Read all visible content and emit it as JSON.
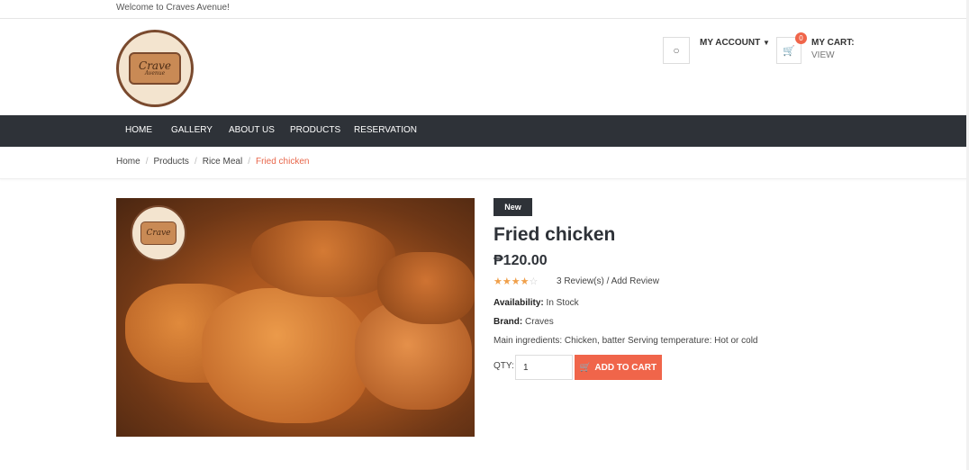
{
  "topbar": {
    "welcome": "Welcome to Craves Avenue!"
  },
  "header": {
    "logo": {
      "line1": "Crave",
      "line2": "Avenue"
    },
    "account": {
      "label": "MY ACCOUNT",
      "icon": "user-icon"
    },
    "cart": {
      "count": "0",
      "title": "MY CART:",
      "view": "VIEW",
      "icon": "cart-icon"
    }
  },
  "nav": {
    "items": [
      "HOME",
      "GALLERY",
      "ABOUT US",
      "PRODUCTS",
      "RESERVATION"
    ]
  },
  "breadcrumb": {
    "items": [
      "Home",
      "Products",
      "Rice Meal",
      "Fried chicken"
    ]
  },
  "product": {
    "badge": "New",
    "name": "Fried chicken",
    "price": "₱120.00",
    "rating": 4,
    "rating_max": 5,
    "reviews_text": "3 Review(s) / Add Review",
    "availability_label": "Availability:",
    "availability_value": "In Stock",
    "brand_label": "Brand:",
    "brand_value": "Craves",
    "description": "Main ingredients: Chicken, batter Serving temperature: Hot or cold",
    "qty_label": "QTY:",
    "qty_value": "1",
    "add_to_cart": "ADD TO CART"
  },
  "colors": {
    "accent": "#f0654a",
    "nav_bg": "#2e3238",
    "star": "#f0a04b"
  }
}
